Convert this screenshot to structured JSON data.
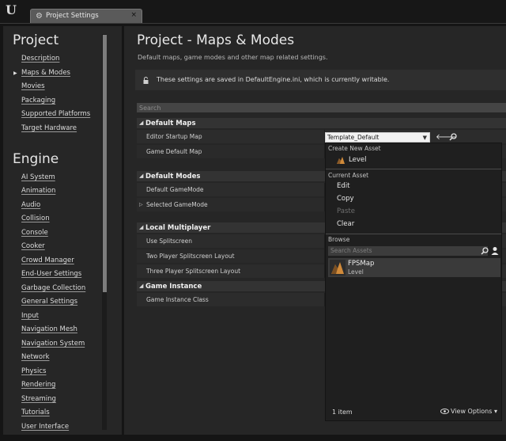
{
  "window": {
    "tab_label": "Project Settings",
    "tab_close": "×",
    "logo_text": "U"
  },
  "sidebar": {
    "sections": [
      {
        "title": "Project",
        "items": [
          {
            "label": "Description",
            "active": false
          },
          {
            "label": "Maps & Modes",
            "active": true
          },
          {
            "label": "Movies",
            "active": false
          },
          {
            "label": "Packaging",
            "active": false
          },
          {
            "label": "Supported Platforms",
            "active": false
          },
          {
            "label": "Target Hardware",
            "active": false
          }
        ]
      },
      {
        "title": "Engine",
        "items": [
          {
            "label": "AI System"
          },
          {
            "label": "Animation"
          },
          {
            "label": "Audio"
          },
          {
            "label": "Collision"
          },
          {
            "label": "Console"
          },
          {
            "label": "Cooker"
          },
          {
            "label": "Crowd Manager"
          },
          {
            "label": "End-User Settings"
          },
          {
            "label": "Garbage Collection"
          },
          {
            "label": "General Settings"
          },
          {
            "label": "Input"
          },
          {
            "label": "Navigation Mesh"
          },
          {
            "label": "Navigation System"
          },
          {
            "label": "Network"
          },
          {
            "label": "Physics"
          },
          {
            "label": "Rendering"
          },
          {
            "label": "Streaming"
          },
          {
            "label": "Tutorials"
          },
          {
            "label": "User Interface"
          }
        ]
      }
    ]
  },
  "main": {
    "title": "Project - Maps & Modes",
    "subtitle": "Default maps, game modes and other map related settings.",
    "info": "These settings are saved in DefaultEngine.ini, which is currently writable.",
    "search_placeholder": "Search",
    "sections": [
      {
        "title": "Default Maps",
        "rows": [
          {
            "label": "Editor Startup Map"
          },
          {
            "label": "Game Default Map"
          }
        ]
      },
      {
        "title": "Default Modes",
        "rows": [
          {
            "label": "Default GameMode"
          },
          {
            "label": "Selected GameMode",
            "expandable": true
          }
        ]
      },
      {
        "title": "Local Multiplayer",
        "rows": [
          {
            "label": "Use Splitscreen"
          },
          {
            "label": "Two Player Splitscreen Layout"
          },
          {
            "label": "Three Player Splitscreen Layout"
          }
        ]
      },
      {
        "title": "Game Instance",
        "rows": [
          {
            "label": "Game Instance Class"
          }
        ]
      }
    ],
    "editor_startup_map_value": "Template_Default"
  },
  "asset_menu": {
    "create_header": "Create New Asset",
    "create_level": "Level",
    "current_header": "Current Asset",
    "edit": "Edit",
    "copy": "Copy",
    "paste": "Paste",
    "clear": "Clear",
    "browse_header": "Browse",
    "search_placeholder": "Search Assets",
    "assets": [
      {
        "name": "FPSMap",
        "type": "Level"
      }
    ],
    "item_count": "1 item",
    "view_options": "View Options"
  },
  "colors": {
    "panel": "#262626",
    "background": "#151515",
    "accent_level_icon": "#d08a3a"
  }
}
